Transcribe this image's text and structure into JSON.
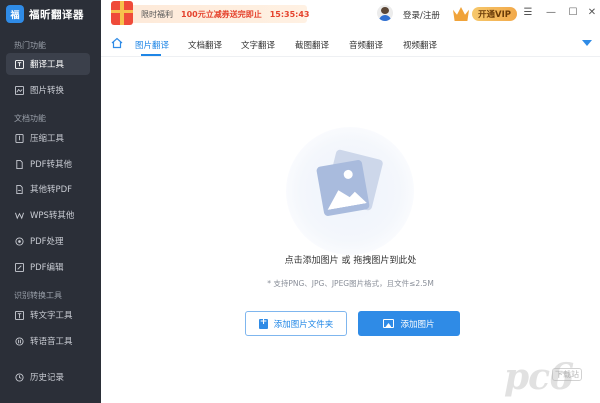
{
  "app": {
    "name": "福昕翻译器",
    "logo_text": "福"
  },
  "sidebar": {
    "sections": [
      {
        "title": "热门功能"
      },
      {
        "title": "文档功能"
      },
      {
        "title": "识别转换工具"
      }
    ],
    "items": [
      {
        "label": "翻译工具",
        "icon": "translate-icon",
        "active": true
      },
      {
        "label": "图片转换",
        "icon": "image-convert-icon"
      },
      {
        "label": "压缩工具",
        "icon": "compress-icon"
      },
      {
        "label": "PDF转其他",
        "icon": "pdf-convert-icon"
      },
      {
        "label": "其他转PDF",
        "icon": "to-pdf-icon"
      },
      {
        "label": "WPS转其他",
        "icon": "wps-icon"
      },
      {
        "label": "PDF处理",
        "icon": "pdf-process-icon"
      },
      {
        "label": "PDF编辑",
        "icon": "pdf-edit-icon"
      },
      {
        "label": "转文字工具",
        "icon": "text-icon"
      },
      {
        "label": "转语音工具",
        "icon": "speech-icon"
      },
      {
        "label": "历史记录",
        "icon": "history-icon"
      }
    ]
  },
  "topbar": {
    "promo": {
      "label": "限时福利",
      "offer": "100元立减券送完即止",
      "countdown": "15:35:43"
    },
    "login": "登录/注册",
    "vip": "开通VIP",
    "window_controls": [
      "☰",
      "—",
      "☐",
      "✕"
    ]
  },
  "tabs": [
    "图片翻译",
    "文档翻译",
    "文字翻译",
    "截图翻译",
    "音频翻译",
    "视频翻译"
  ],
  "drop": {
    "main_hint": "点击添加图片 或 拖拽图片到此处",
    "sub_hint": "* 支持PNG、JPG、JPEG图片格式，且文件≤2.5M",
    "add_folder": "添加图片文件夹",
    "add_image": "添加图片"
  },
  "watermark": {
    "text": "pc6",
    "badge": "下载站"
  },
  "colors": {
    "sidebar_bg": "#2b2f38",
    "accent": "#2f8be6",
    "promo_red": "#e5432e"
  }
}
